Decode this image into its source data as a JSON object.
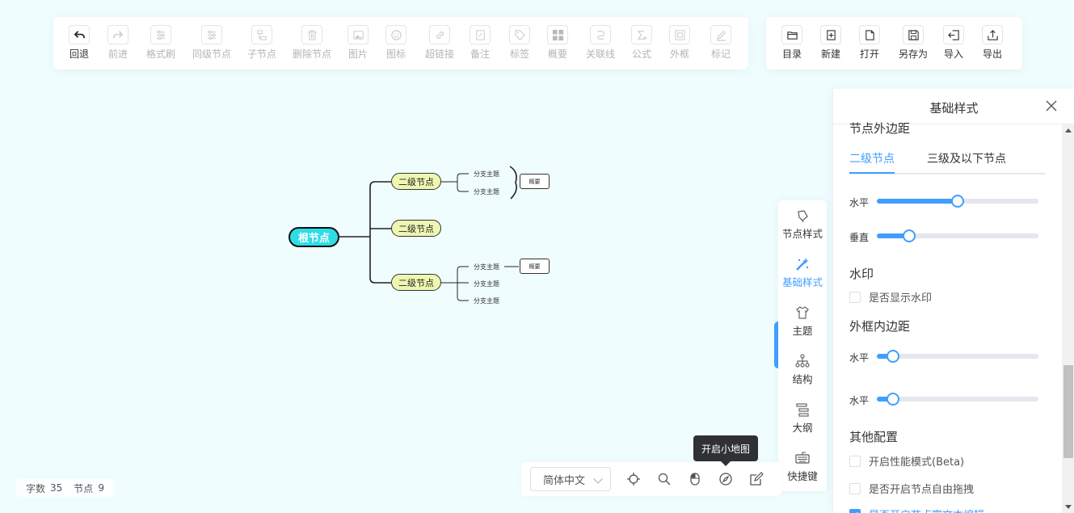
{
  "toolbar_left": [
    {
      "label": "回退",
      "icon": "undo-icon",
      "enabled": true
    },
    {
      "label": "前进",
      "icon": "redo-icon",
      "enabled": false
    },
    {
      "label": "格式刷",
      "icon": "format-painter-icon",
      "enabled": false
    },
    {
      "label": "同级节点",
      "icon": "sibling-node-icon",
      "enabled": false
    },
    {
      "label": "子节点",
      "icon": "child-node-icon",
      "enabled": false
    },
    {
      "label": "删除节点",
      "icon": "delete-node-icon",
      "enabled": false
    },
    {
      "label": "图片",
      "icon": "image-icon",
      "enabled": false
    },
    {
      "label": "图标",
      "icon": "emoji-icon",
      "enabled": false
    },
    {
      "label": "超链接",
      "icon": "link-icon",
      "enabled": false
    },
    {
      "label": "备注",
      "icon": "note-icon",
      "enabled": false
    },
    {
      "label": "标签",
      "icon": "tag-icon",
      "enabled": false
    },
    {
      "label": "概要",
      "icon": "summary-icon",
      "enabled": false
    },
    {
      "label": "关联线",
      "icon": "association-line-icon",
      "enabled": false
    },
    {
      "label": "公式",
      "icon": "formula-icon",
      "enabled": false
    },
    {
      "label": "外框",
      "icon": "outer-frame-icon",
      "enabled": false
    },
    {
      "label": "标记",
      "icon": "mark-icon",
      "enabled": false
    }
  ],
  "toolbar_right": [
    {
      "label": "目录",
      "icon": "folder-icon"
    },
    {
      "label": "新建",
      "icon": "new-file-icon"
    },
    {
      "label": "打开",
      "icon": "open-file-icon"
    },
    {
      "label": "另存为",
      "icon": "save-as-icon"
    },
    {
      "label": "导入",
      "icon": "import-icon"
    },
    {
      "label": "导出",
      "icon": "export-icon"
    }
  ],
  "mindmap": {
    "root": "根节点",
    "second_level": [
      "二级节点",
      "二级节点",
      "二级节点"
    ],
    "branch_topic": "分支主题",
    "summary": "概要"
  },
  "side_tabs": [
    {
      "label": "节点样式",
      "icon": "node-style-icon",
      "active": false
    },
    {
      "label": "基础样式",
      "icon": "magic-wand-icon",
      "active": true
    },
    {
      "label": "主题",
      "icon": "shirt-icon",
      "active": false
    },
    {
      "label": "结构",
      "icon": "structure-icon",
      "active": false
    },
    {
      "label": "大纲",
      "icon": "outline-icon",
      "active": false
    },
    {
      "label": "快捷键",
      "icon": "keyboard-icon",
      "active": false
    }
  ],
  "panel": {
    "title": "基础样式",
    "node_margin_title": "节点外边距",
    "tabs": [
      "二级节点",
      "三级及以下节点"
    ],
    "node_margin_sliders": [
      {
        "label": "水平",
        "value": 0.5
      },
      {
        "label": "垂直",
        "value": 0.2
      }
    ],
    "watermark_title": "水印",
    "watermark_checkbox": "是否显示水印",
    "frame_padding_title": "外框内边距",
    "frame_padding_sliders": [
      {
        "label": "水平",
        "value": 0.1
      },
      {
        "label": "水平",
        "value": 0.1
      }
    ],
    "other_title": "其他配置",
    "other_options": [
      {
        "label": "开启性能模式(Beta)",
        "checked": false
      },
      {
        "label": "是否开启节点自由拖拽",
        "checked": false
      },
      {
        "label": "是否开启节点富文本编辑",
        "checked": true
      }
    ]
  },
  "status": {
    "word_count_label": "字数",
    "word_count": "35",
    "node_count_label": "节点",
    "node_count": "9"
  },
  "bottom": {
    "language": "简体中文",
    "tooltip": "开启小地图"
  },
  "colors": {
    "accent": "#409eff",
    "canvas_bg": "#effdff",
    "root_fill": "#2cdde6",
    "second_fill": "#eef7b0"
  }
}
